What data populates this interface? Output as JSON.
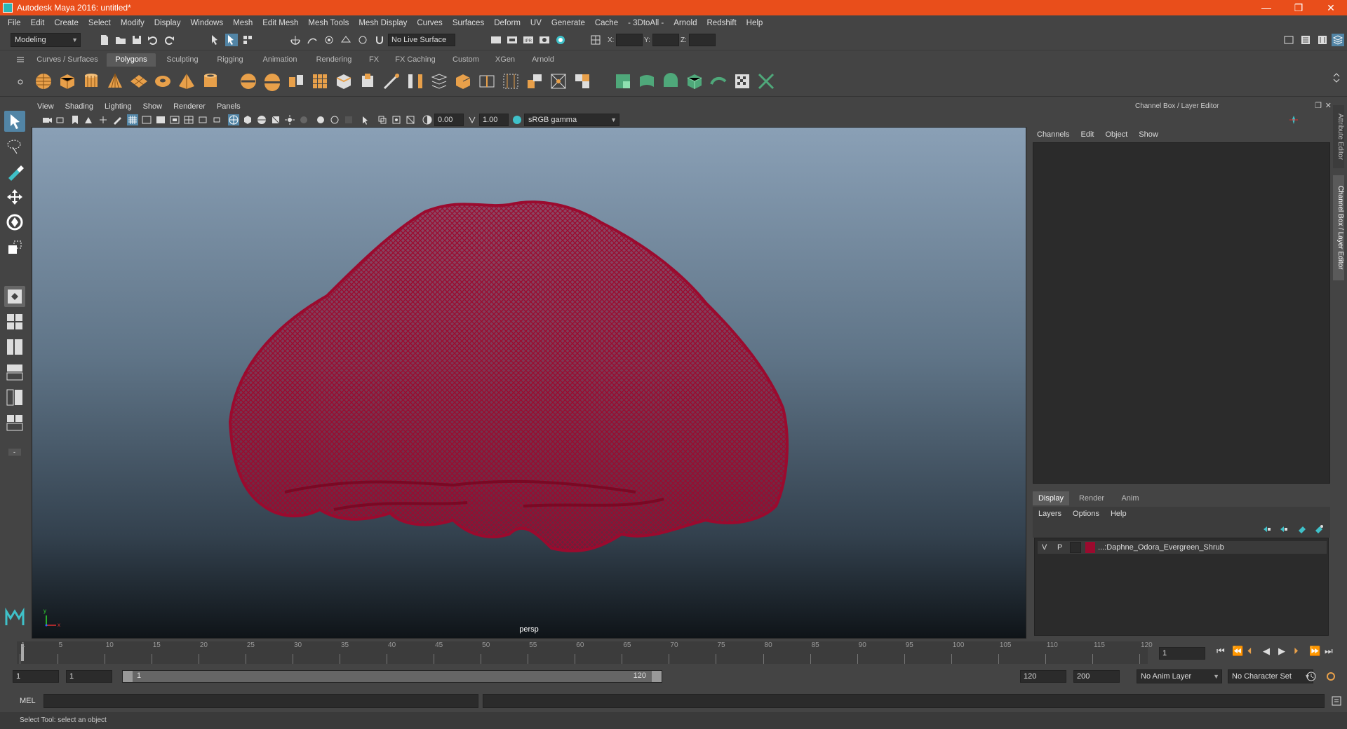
{
  "window": {
    "title": "Autodesk Maya 2016: untitled*",
    "controls": [
      "—",
      "❐",
      "✕"
    ]
  },
  "menubar": [
    "File",
    "Edit",
    "Create",
    "Select",
    "Modify",
    "Display",
    "Windows",
    "Mesh",
    "Edit Mesh",
    "Mesh Tools",
    "Mesh Display",
    "Curves",
    "Surfaces",
    "Deform",
    "UV",
    "Generate",
    "Cache",
    "- 3DtoAll -",
    "Arnold",
    "Redshift",
    "Help"
  ],
  "statusline": {
    "menuset": "Modeling",
    "live_surface": "No Live Surface",
    "x_label": "X:",
    "y_label": "Y:",
    "z_label": "Z:"
  },
  "shelf_tabs": [
    "Curves / Surfaces",
    "Polygons",
    "Sculpting",
    "Rigging",
    "Animation",
    "Rendering",
    "FX",
    "FX Caching",
    "Custom",
    "XGen",
    "Arnold"
  ],
  "shelf_active": "Polygons",
  "viewport": {
    "menu": [
      "View",
      "Shading",
      "Lighting",
      "Show",
      "Renderer",
      "Panels"
    ],
    "exposure": "0.00",
    "gamma": "1.00",
    "color_space": "sRGB gamma",
    "camera": "persp",
    "object_color": "#9b0a2e"
  },
  "channelbox": {
    "title": "Channel Box / Layer Editor",
    "menu": [
      "Channels",
      "Edit",
      "Object",
      "Show"
    ],
    "side_tabs": [
      "Attribute Editor",
      "Channel Box / Layer Editor"
    ]
  },
  "layers": {
    "tabs": [
      "Display",
      "Render",
      "Anim"
    ],
    "active_tab": "Display",
    "menu": [
      "Layers",
      "Options",
      "Help"
    ],
    "rows": [
      {
        "visible": "V",
        "playback": "P",
        "color": "#9b0a2e",
        "name": "...:Daphne_Odora_Evergreen_Shrub"
      }
    ]
  },
  "timeslider": {
    "ticks": [
      "1",
      "5",
      "10",
      "15",
      "20",
      "25",
      "30",
      "35",
      "40",
      "45",
      "50",
      "55",
      "60",
      "65",
      "70",
      "75",
      "80",
      "85",
      "90",
      "95",
      "100",
      "105",
      "110",
      "115",
      "120"
    ],
    "current_frame": "1"
  },
  "rangeslider": {
    "start": "1",
    "playback_start": "1",
    "range_start_label": "1",
    "range_end_label": "120",
    "playback_end": "120",
    "end": "200",
    "anim_layer": "No Anim Layer",
    "character_set": "No Character Set"
  },
  "cmdline": {
    "lang": "MEL"
  },
  "helpline": "Select Tool: select an object"
}
